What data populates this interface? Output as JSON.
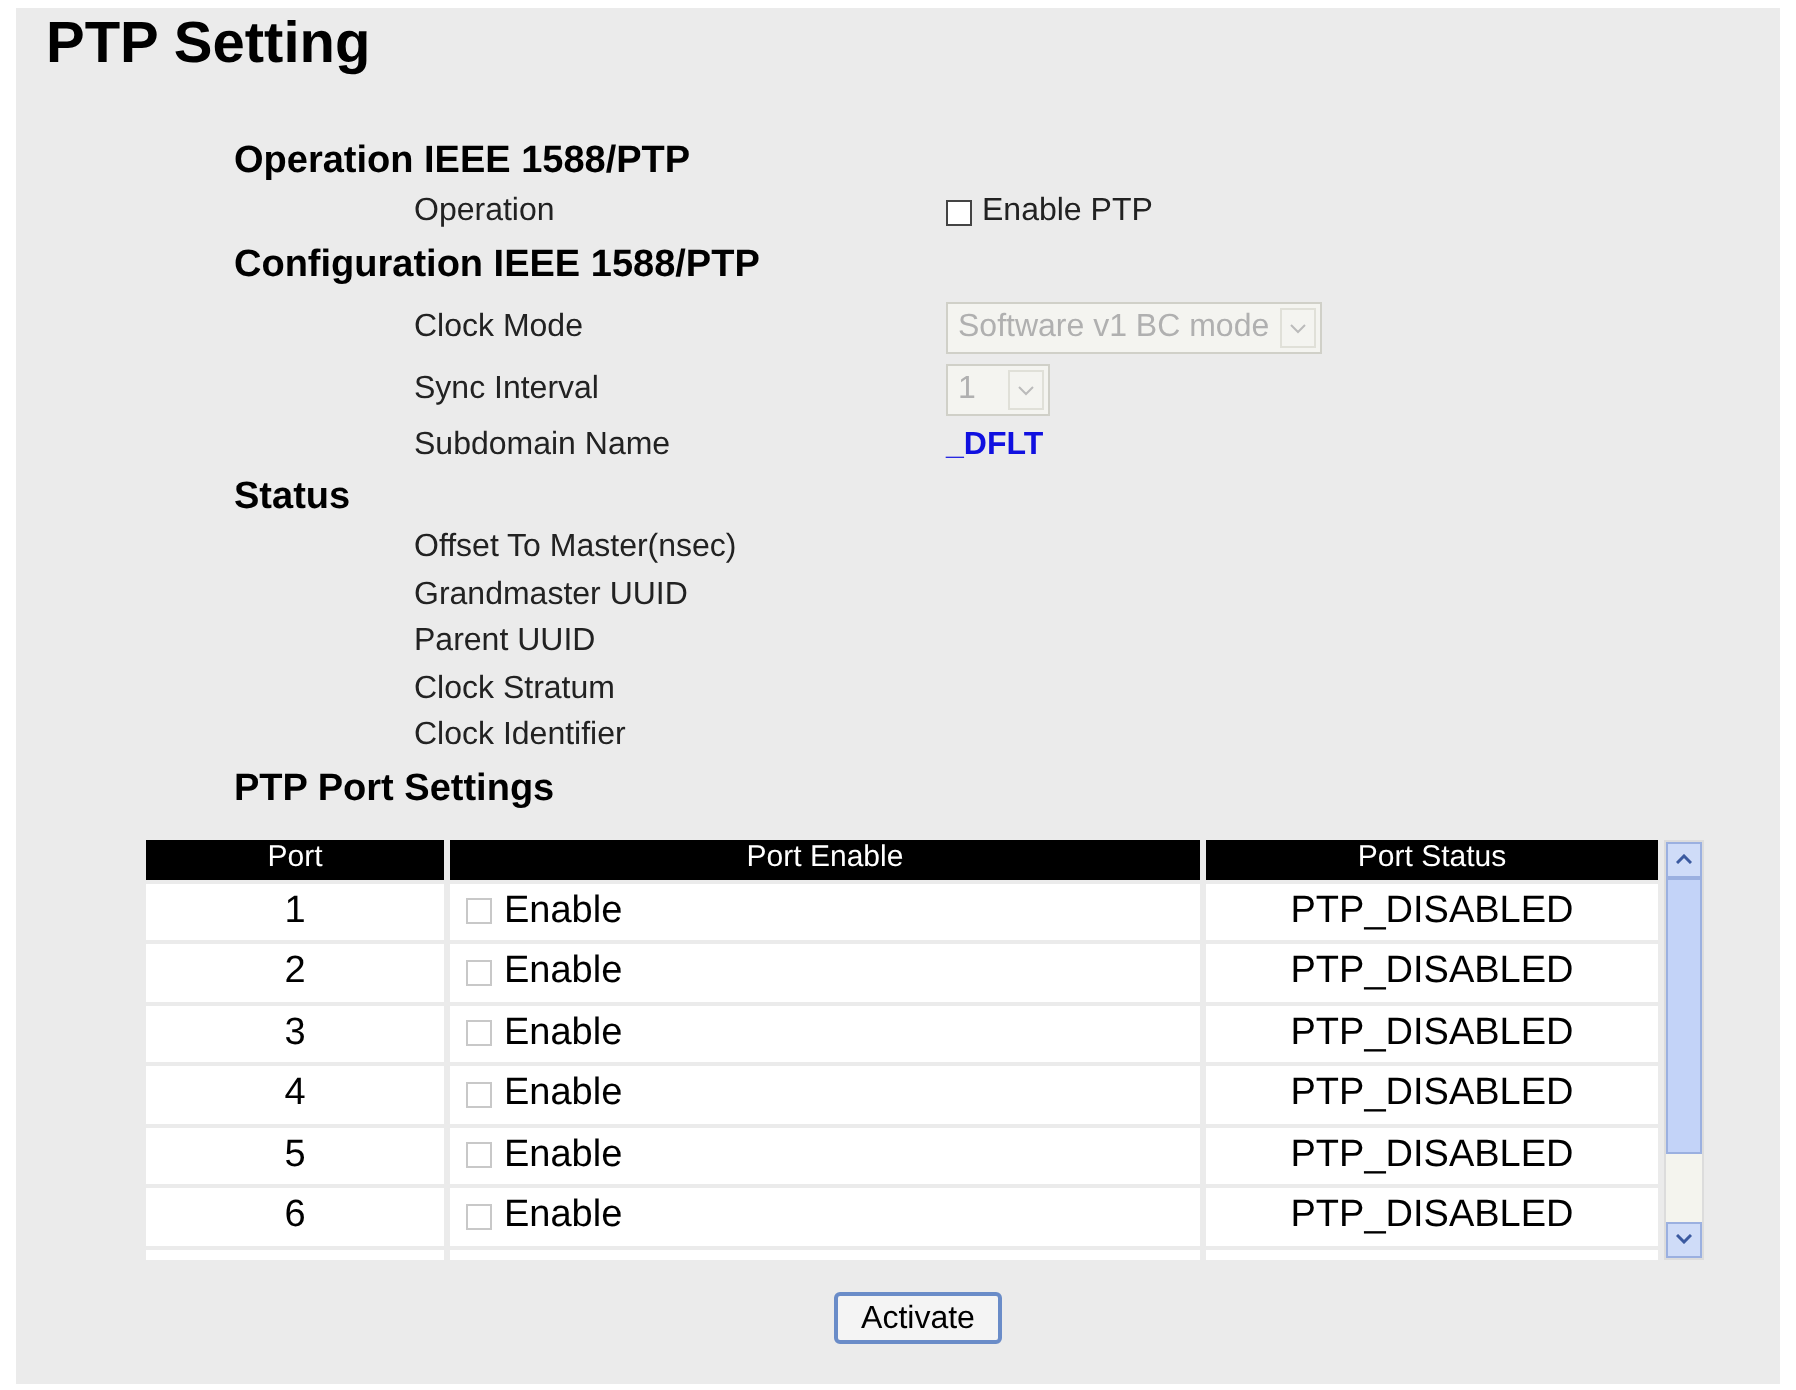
{
  "title": "PTP Setting",
  "operation": {
    "heading": "Operation IEEE 1588/PTP",
    "label": "Operation",
    "checkbox": {
      "label": "Enable PTP",
      "checked": false
    }
  },
  "configuration": {
    "heading": "Configuration IEEE 1588/PTP",
    "clock_mode": {
      "label": "Clock Mode",
      "value": "Software v1 BC mode",
      "disabled": true
    },
    "sync_interval": {
      "label": "Sync Interval",
      "value": "1",
      "disabled": true
    },
    "subdomain": {
      "label": "Subdomain Name",
      "value": "_DFLT"
    }
  },
  "status": {
    "heading": "Status",
    "items": [
      "Offset To Master(nsec)",
      "Grandmaster UUID",
      "Parent UUID",
      "Clock Stratum",
      "Clock Identifier"
    ]
  },
  "port_settings": {
    "heading": "PTP Port Settings",
    "columns": [
      "Port",
      "Port Enable",
      "Port Status"
    ],
    "rows": [
      {
        "port": "1",
        "enable_label": "Enable",
        "checked": false,
        "status": "PTP_DISABLED"
      },
      {
        "port": "2",
        "enable_label": "Enable",
        "checked": false,
        "status": "PTP_DISABLED"
      },
      {
        "port": "3",
        "enable_label": "Enable",
        "checked": false,
        "status": "PTP_DISABLED"
      },
      {
        "port": "4",
        "enable_label": "Enable",
        "checked": false,
        "status": "PTP_DISABLED"
      },
      {
        "port": "5",
        "enable_label": "Enable",
        "checked": false,
        "status": "PTP_DISABLED"
      },
      {
        "port": "6",
        "enable_label": "Enable",
        "checked": false,
        "status": "PTP_DISABLED"
      }
    ]
  },
  "button": "Activate"
}
